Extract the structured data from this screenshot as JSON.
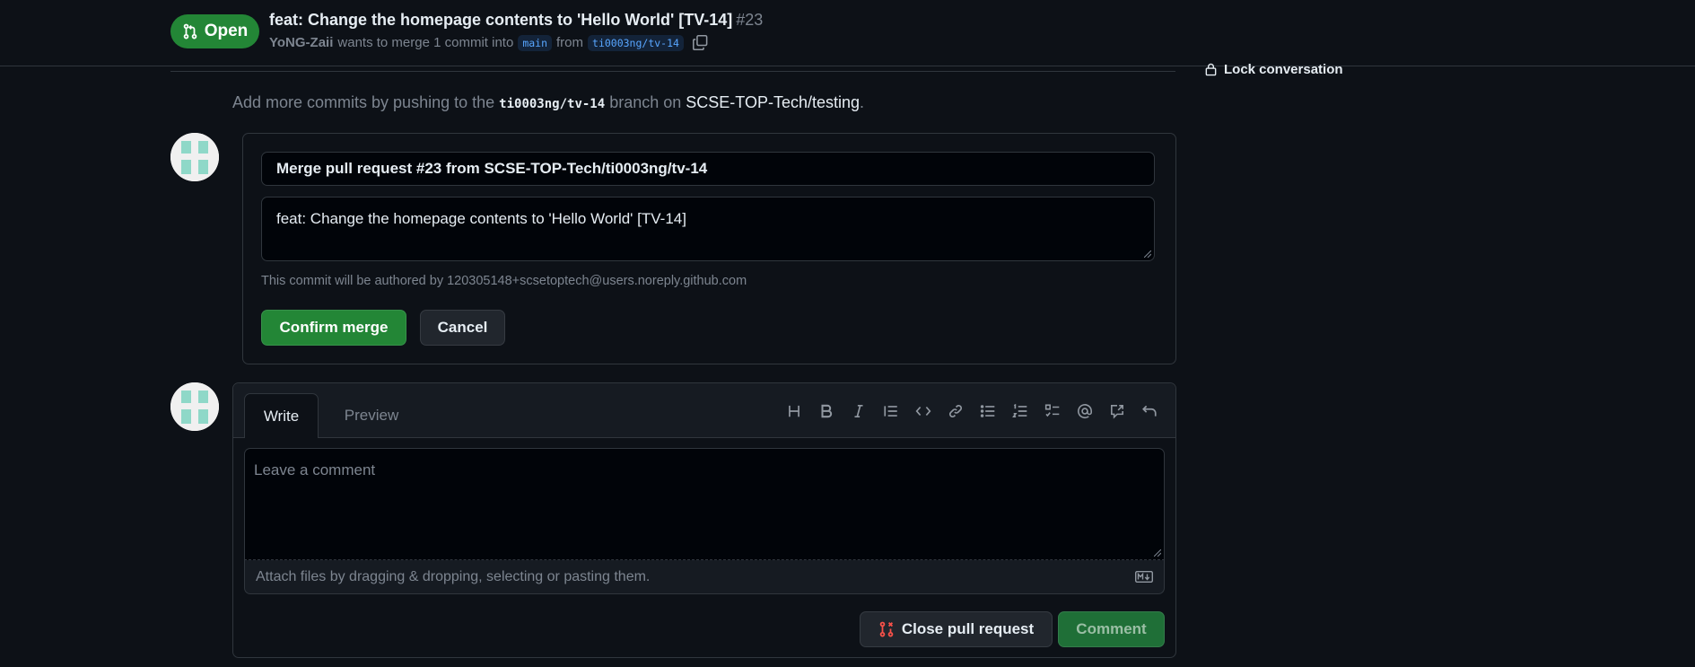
{
  "header": {
    "state_label": "Open",
    "title": "feat: Change the homepage contents to 'Hello World' [TV-14]",
    "number": "#23",
    "author": "YoNG-Zaii",
    "merge_text": "wants to merge 1 commit into",
    "base_branch": "main",
    "from_text": "from",
    "head_branch": "ti0003ng/tv-14",
    "copy_icon": "copy-icon"
  },
  "sidebar": {
    "lock_label": "Lock conversation",
    "lock_icon": "lock-icon"
  },
  "push_hint": {
    "prefix": "Add more commits by pushing to the",
    "branch": "ti0003ng/tv-14",
    "middle": "branch on",
    "repo": "SCSE-TOP-Tech/testing",
    "suffix": "."
  },
  "merge_form": {
    "title_value": "Merge pull request #23 from SCSE-TOP-Tech/ti0003ng/tv-14",
    "body_value": "feat: Change the homepage contents to 'Hello World' [TV-14]",
    "author_note": "This commit will be authored by 120305148+scsetoptech@users.noreply.github.com",
    "confirm_label": "Confirm merge",
    "cancel_label": "Cancel"
  },
  "comment_form": {
    "tabs": [
      "Write",
      "Preview"
    ],
    "toolbar_icons": [
      "heading-icon",
      "bold-icon",
      "italic-icon",
      "quote-icon",
      "code-icon",
      "link-icon",
      "bulleted-list-icon",
      "numbered-list-icon",
      "task-list-icon",
      "mention-icon",
      "cross-reference-icon",
      "undo-icon"
    ],
    "placeholder": "Leave a comment",
    "attach_hint": "Attach files by dragging & dropping, selecting or pasting them.",
    "close_pr_label": "Close pull request",
    "comment_label": "Comment"
  },
  "colors": {
    "background": "#0d1117",
    "open_badge": "#238636",
    "accent_link": "#58a6ff",
    "close_icon": "#f85149"
  }
}
